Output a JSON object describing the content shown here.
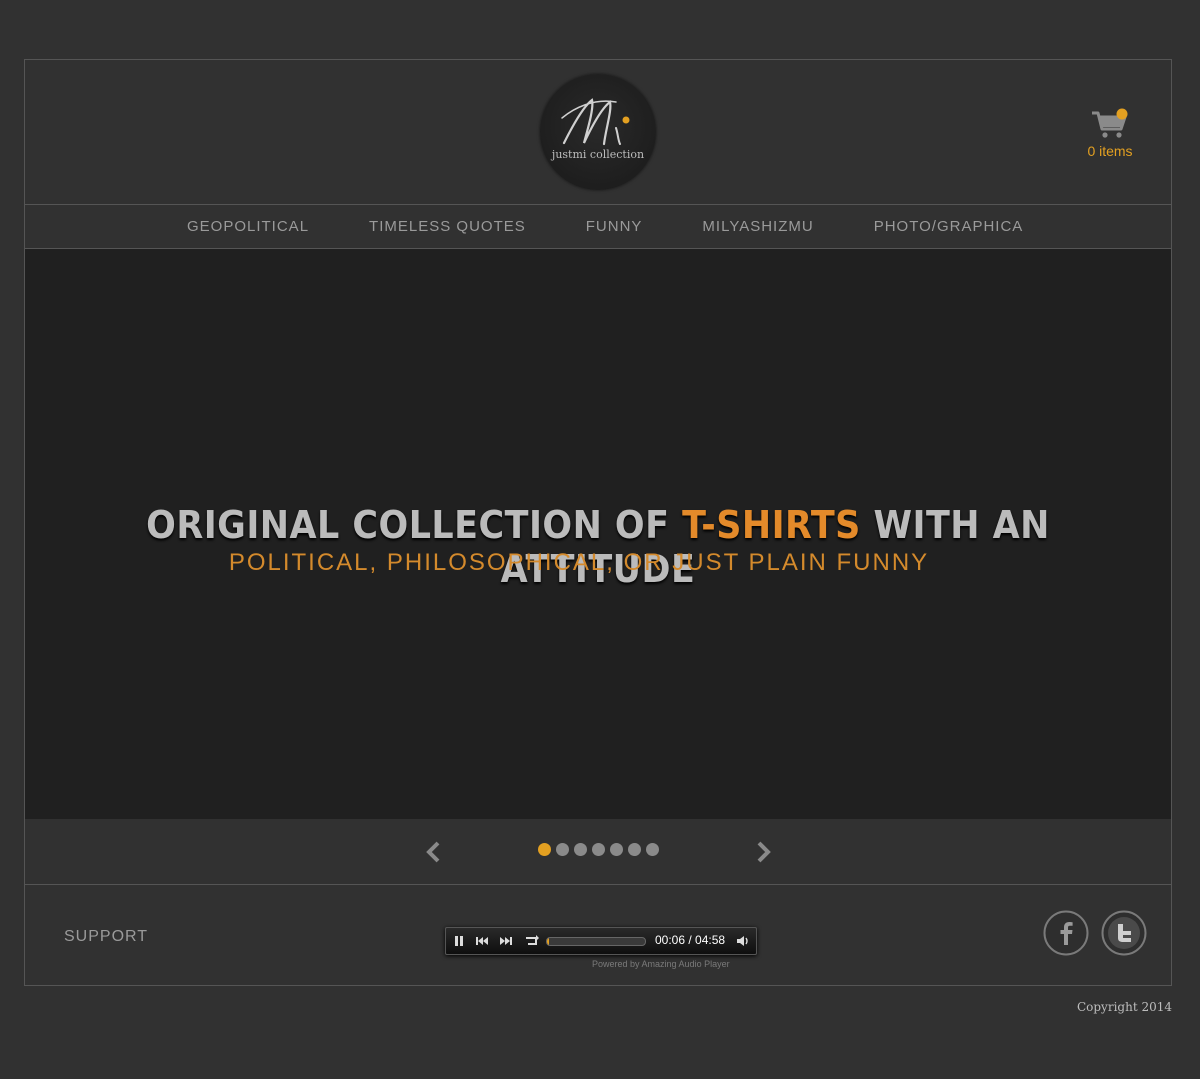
{
  "brand": {
    "logo_text": "justmi collection",
    "logo_mark": "Mi"
  },
  "cart": {
    "label": "0 items",
    "icon": "cart-icon",
    "badge_color": "#e3a021"
  },
  "nav": {
    "items": [
      {
        "label": "GEOPOLITICAL"
      },
      {
        "label": "TIMELESS QUOTES"
      },
      {
        "label": "FUNNY"
      },
      {
        "label": "MILYASHIZMU"
      },
      {
        "label": "PHOTO/GRAPHICA"
      }
    ]
  },
  "slide": {
    "title_pre": "ORIGINAL COLLECTION OF ",
    "title_highlight": "T-SHIRTS",
    "title_post": " WITH AN ATTITUDE",
    "subtitle": "POLITICAL, PHILOSOPHICAL, OR JUST PLAIN FUNNY"
  },
  "slider_controls": {
    "prev_icon": "chevron-left-icon",
    "next_icon": "chevron-right-icon",
    "dot_count": 7,
    "active_index": 0
  },
  "footer": {
    "support_label": "SUPPORT",
    "player": {
      "time": "00:06 / 04:58",
      "progress": 0.02,
      "powered_by": "Powered by Amazing Audio Player"
    },
    "social": [
      {
        "name": "facebook",
        "icon": "facebook-icon"
      },
      {
        "name": "twitter",
        "icon": "twitter-icon"
      }
    ]
  },
  "copyright": "Copyright 2014",
  "colors": {
    "accent": "#e3a021",
    "background": "#313131",
    "slider_bg": "#202020"
  }
}
